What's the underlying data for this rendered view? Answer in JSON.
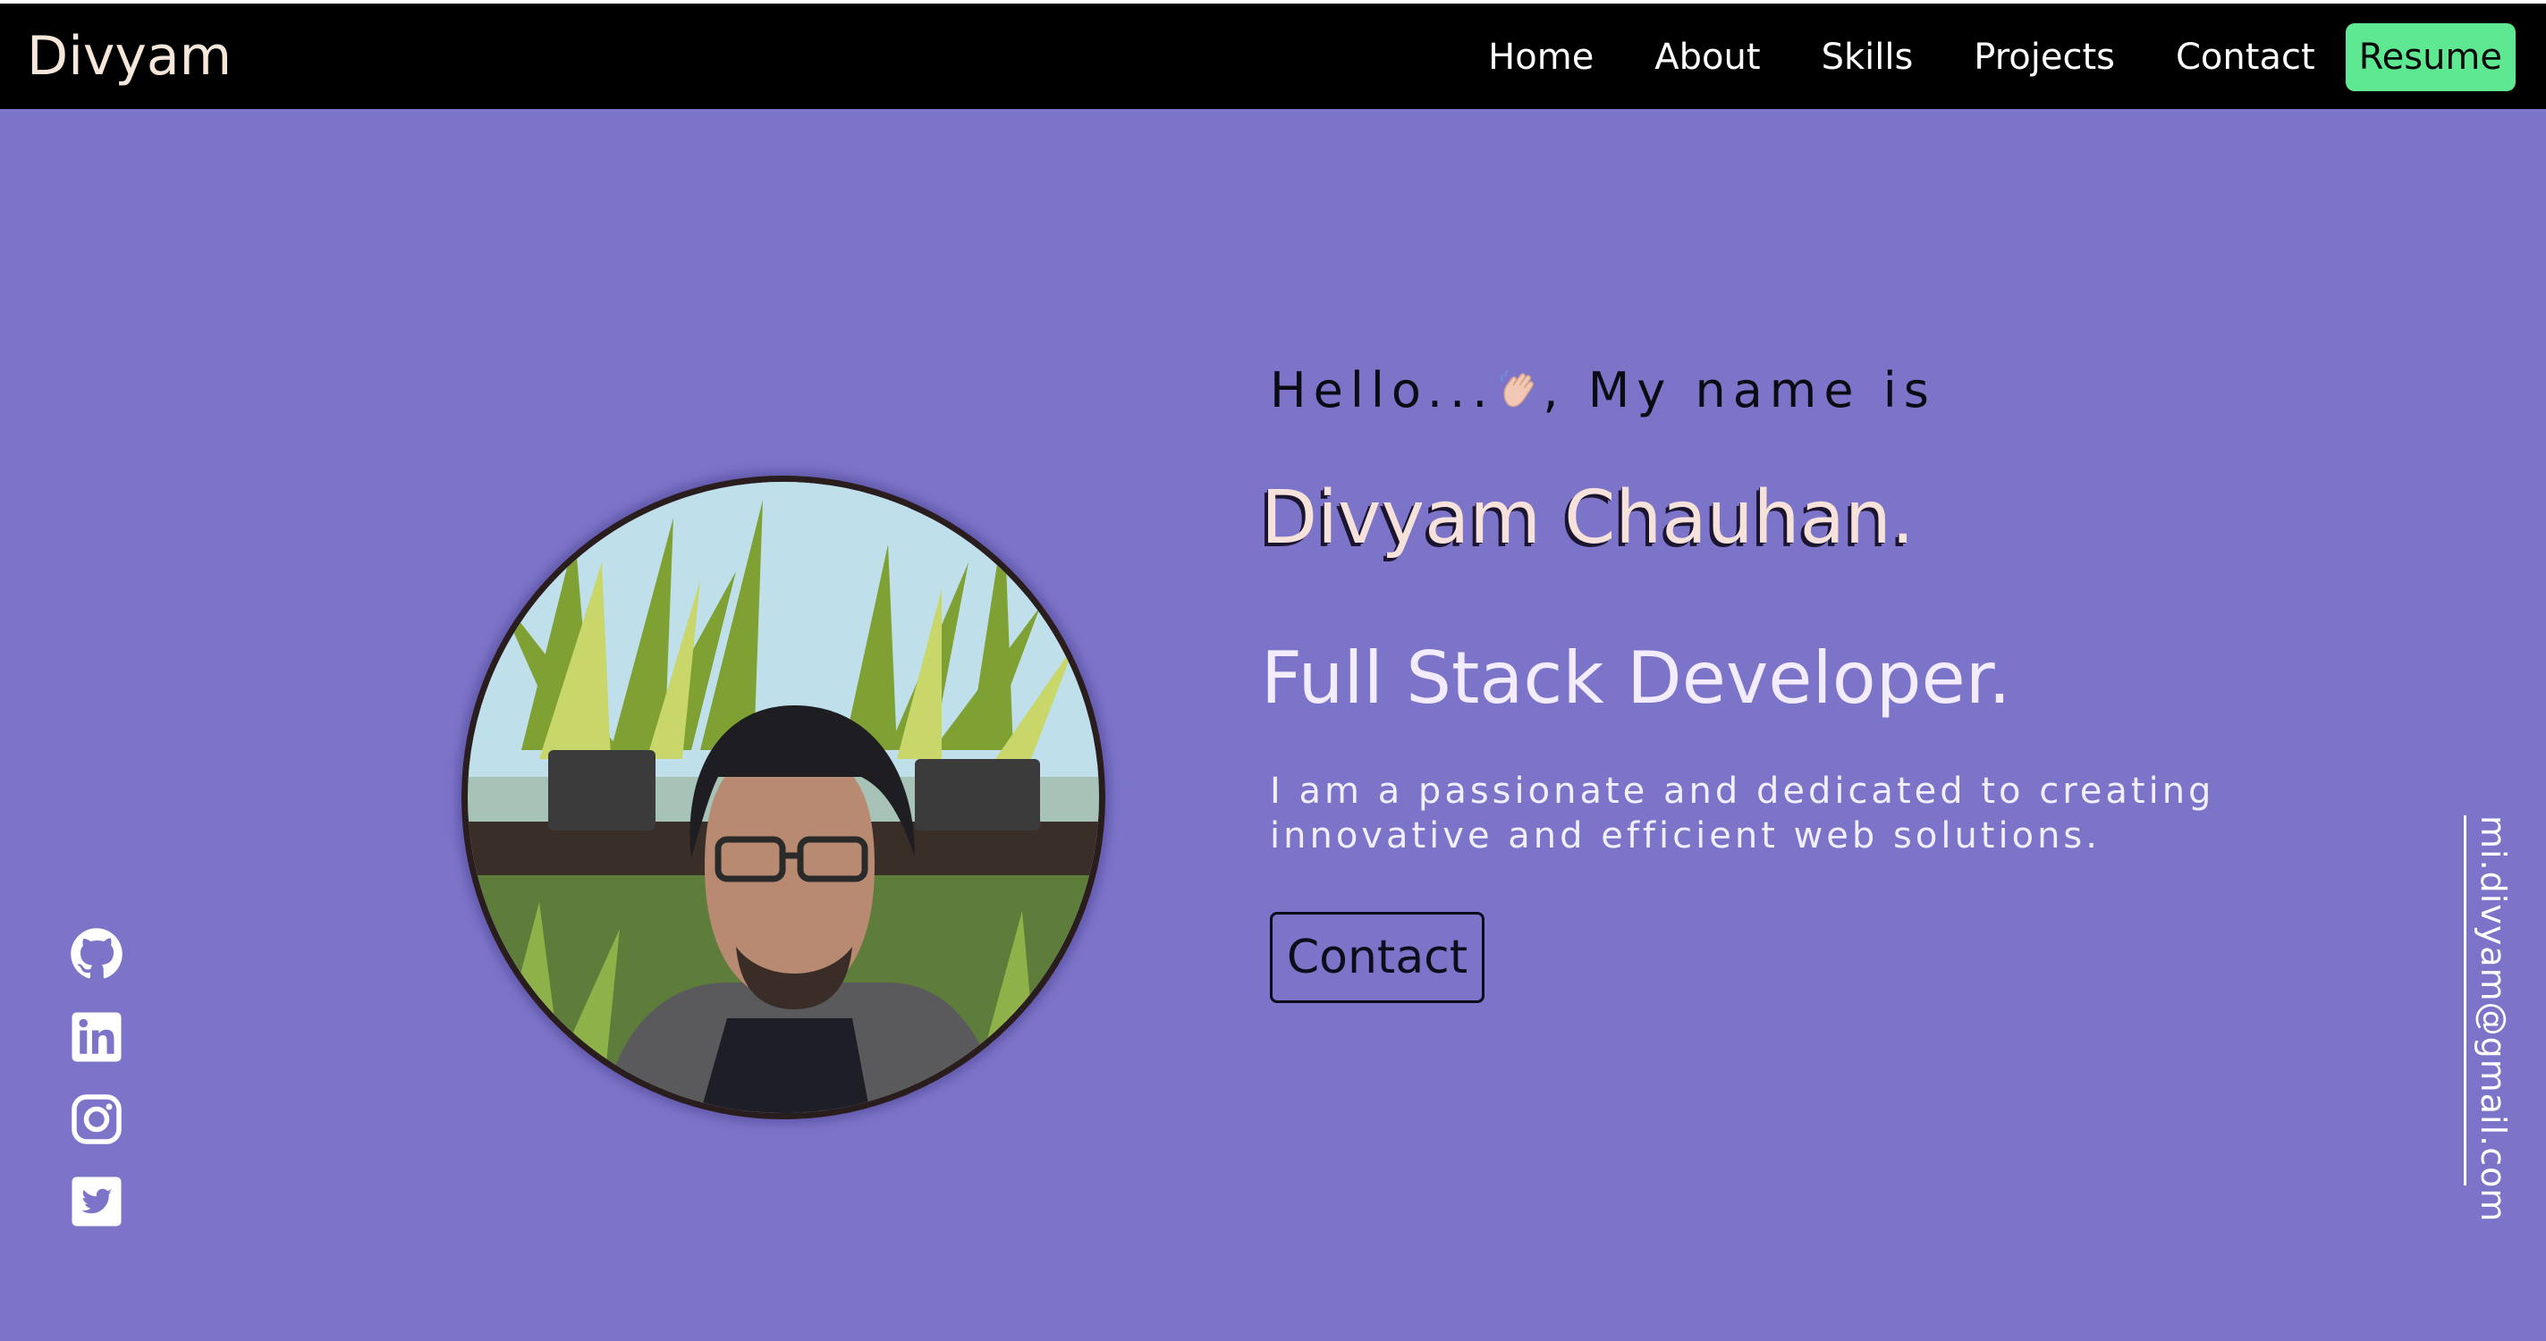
{
  "nav": {
    "brand": "Divyam",
    "links": [
      "Home",
      "About",
      "Skills",
      "Projects",
      "Contact"
    ],
    "resume_label": "Resume"
  },
  "hero": {
    "greeting_before": "Hello...",
    "greeting_after": ", My name is",
    "wave_icon": "waving-hand-icon",
    "name": "Divyam Chauhan.",
    "role": "Full Stack Developer.",
    "description_line1": "I am a passionate and dedicated to creating",
    "description_line2": "innovative and efficient web solutions.",
    "contact_label": "Contact",
    "photo": "profile-photo"
  },
  "social_icons": [
    "github-icon",
    "linkedin-icon",
    "instagram-icon",
    "twitter-icon"
  ],
  "email": "mi.divyam@gmail.com",
  "colors": {
    "background": "#7b74c8",
    "navbar": "#000000",
    "resume_button": "#5ee892",
    "brand_text": "#f7e7da"
  }
}
